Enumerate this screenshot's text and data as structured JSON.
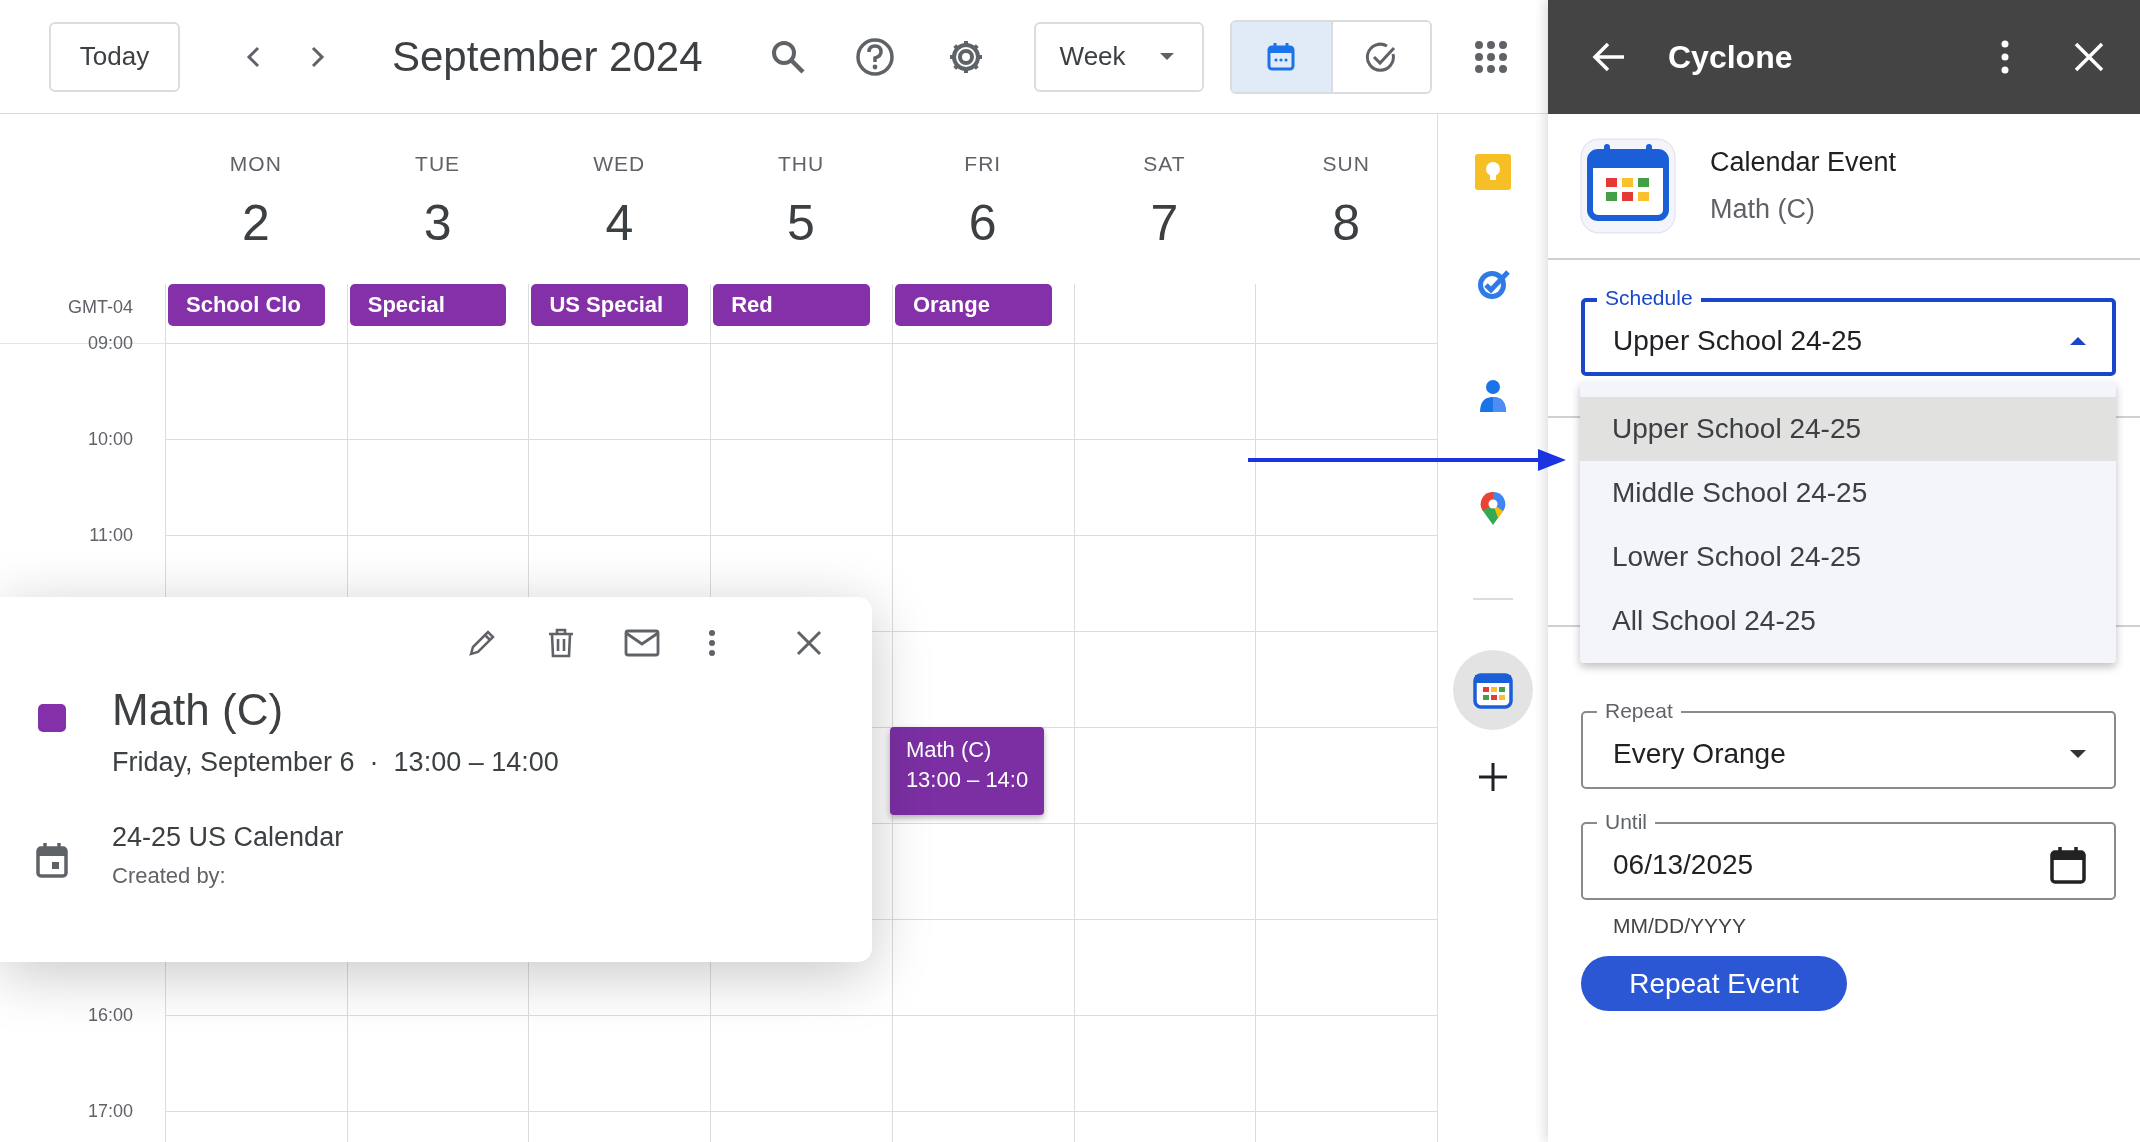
{
  "toolbar": {
    "today": "Today",
    "title": "September 2024",
    "view": "Week"
  },
  "view_toggle": [
    {
      "kind": "calendar",
      "selected": true
    },
    {
      "kind": "tasks",
      "selected": false
    }
  ],
  "timezone": "GMT-04",
  "days": [
    {
      "name": "MON",
      "number": "2",
      "all_day": "School Clo"
    },
    {
      "name": "TUE",
      "number": "3",
      "all_day": "Special"
    },
    {
      "name": "WED",
      "number": "4",
      "all_day": "US Special"
    },
    {
      "name": "THU",
      "number": "5",
      "all_day": "Red"
    },
    {
      "name": "FRI",
      "number": "6",
      "all_day": "Orange",
      "event": {
        "title": "Math (C)",
        "time": "13:00 – 14:0"
      }
    },
    {
      "name": "SAT",
      "number": "7"
    },
    {
      "name": "SUN",
      "number": "8"
    }
  ],
  "hours_above": [
    "09:00",
    "10:00",
    "11:00"
  ],
  "hours_below": [
    "16:00",
    "17:00"
  ],
  "popup": {
    "title": "Math (C)",
    "when": "Friday, September 6  ·  13:00 – 14:00",
    "calendar": "24-25 US Calendar",
    "created_by": "Created by:"
  },
  "side_rail": [
    {
      "kind": "keep",
      "selected": false
    },
    {
      "kind": "tasks",
      "selected": false
    },
    {
      "kind": "contacts",
      "selected": false
    },
    {
      "kind": "maps",
      "selected": false
    },
    {
      "kind": "cyclone",
      "selected": true
    }
  ],
  "panel": {
    "title": "Cyclone",
    "card": {
      "heading": "Calendar Event",
      "subtitle": "Math (C)"
    },
    "schedule": {
      "label": "Schedule",
      "value": "Upper School 24-25",
      "expanded": true,
      "options": [
        {
          "label": "Upper School 24-25",
          "selected": true
        },
        {
          "label": "Middle School 24-25",
          "selected": false
        },
        {
          "label": "Lower School 24-25",
          "selected": false
        },
        {
          "label": "All School 24-25",
          "selected": false
        }
      ]
    },
    "repeat": {
      "label": "Repeat",
      "value": "Every Orange"
    },
    "until": {
      "label": "Until",
      "value": "06/13/2025",
      "hint": "MM/DD/YYYY"
    },
    "button": "Repeat Event"
  }
}
